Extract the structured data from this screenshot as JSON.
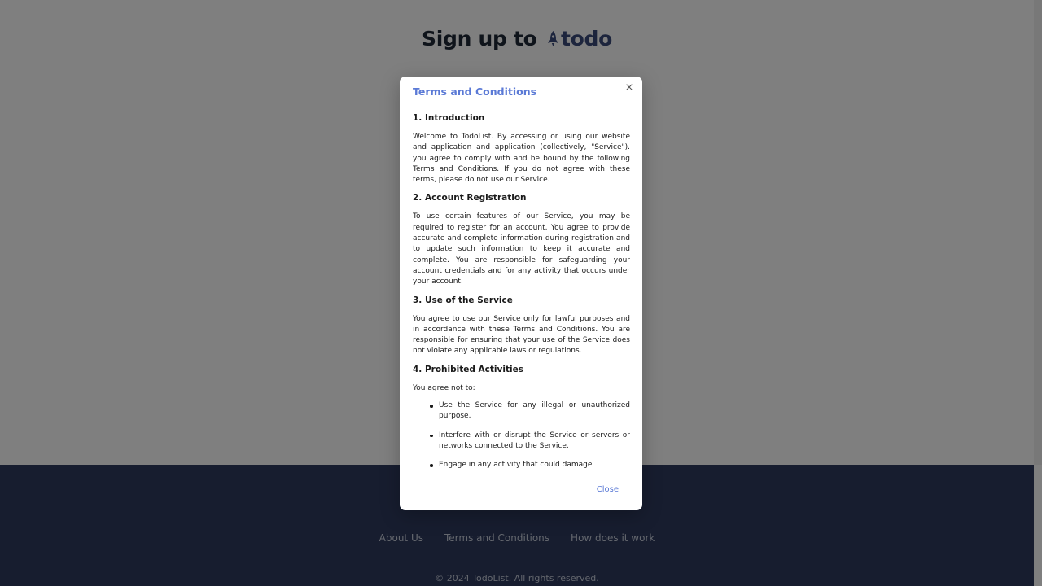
{
  "page": {
    "title_prefix": "Sign up to",
    "brand": "todo"
  },
  "footer": {
    "links": [
      "About Us",
      "Terms and Conditions",
      "How does it work"
    ],
    "copyright": "© 2024 TodoList. All rights reserved."
  },
  "modal": {
    "title": "Terms and Conditions",
    "close_label": "Close",
    "sections": [
      {
        "heading": "1. Introduction",
        "text": "Welcome to TodoList. By accessing or using our website and application and application (collectively, \"Service\"). you agree to comply with and be bound by the following Terms and Conditions. If you do not agree with these terms, please do not use our Service."
      },
      {
        "heading": "2. Account Registration",
        "text": "To use certain features of our Service, you may be required to register for an account. You agree to provide accurate and complete information during registration and to update such information to keep it accurate and complete. You are responsible for safeguarding your account credentials and for any activity that occurs under your account."
      },
      {
        "heading": "3. Use of the Service",
        "text": "You agree to use our Service only for lawful purposes and in accordance with these Terms and Conditions. You are responsible for ensuring that your use of the Service does not violate any applicable laws or regulations."
      },
      {
        "heading": "4. Prohibited Activities",
        "text": "You agree not to:",
        "items": [
          "Use the Service for any illegal or unauthorized purpose.",
          "Interfere with or disrupt the Service or servers or networks connected to the Service.",
          "Engage in any activity that could damage"
        ]
      }
    ]
  },
  "colors": {
    "accent": "#5b7ad6",
    "brand": "#3b4a7a",
    "footer_bg": "#2e3b5e",
    "overlay": "rgba(0,0,0,0.5)"
  },
  "icons": {
    "brand_logo": "rocket-icon",
    "close": "close-icon"
  }
}
